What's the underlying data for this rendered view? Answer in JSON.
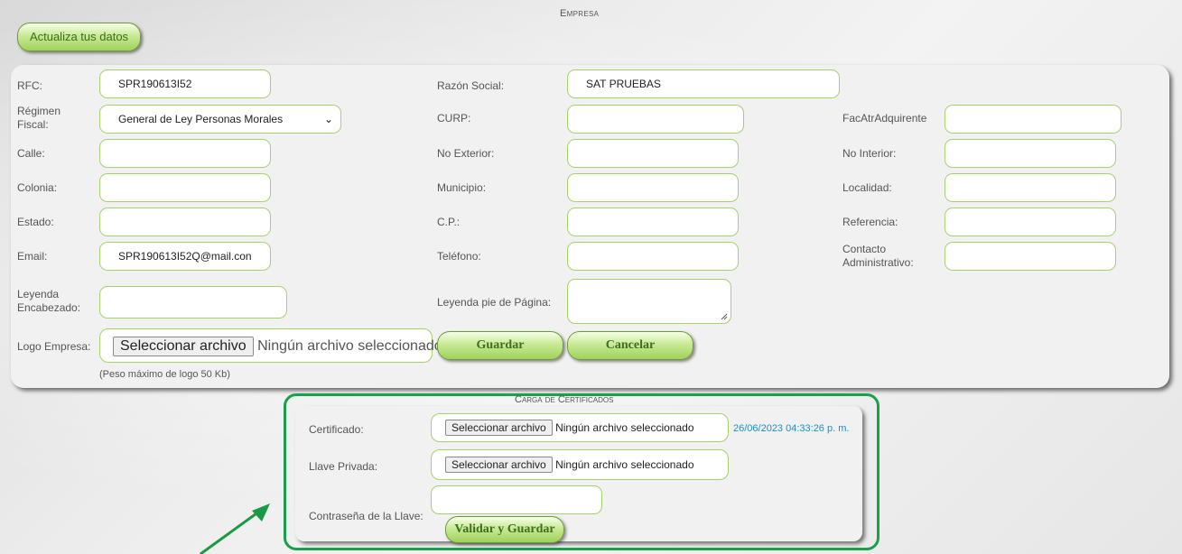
{
  "header": {
    "title": "Empresa",
    "update_button": "Actualiza tus datos"
  },
  "form": {
    "rfc": {
      "label": "RFC:",
      "value": "SPR190613I52"
    },
    "razon_social": {
      "label": "Razón Social:",
      "value": "SAT PRUEBAS"
    },
    "regimen_fiscal": {
      "label_line1": "Régimen",
      "label_line2": "Fiscal:",
      "value": "General de Ley Personas Morales"
    },
    "curp": {
      "label": "CURP:",
      "value": ""
    },
    "fac_atr": {
      "label": "FacAtrAdquirente",
      "value": ""
    },
    "calle": {
      "label": "Calle:",
      "value": ""
    },
    "no_exterior": {
      "label": "No Exterior:",
      "value": ""
    },
    "no_interior": {
      "label": "No Interior:",
      "value": ""
    },
    "colonia": {
      "label": "Colonia:",
      "value": ""
    },
    "municipio": {
      "label": "Municipio:",
      "value": ""
    },
    "localidad": {
      "label": "Localidad:",
      "value": ""
    },
    "estado": {
      "label": "Estado:",
      "value": ""
    },
    "cp": {
      "label": "C.P.:",
      "value": ""
    },
    "referencia": {
      "label": "Referencia:",
      "value": ""
    },
    "email": {
      "label": "Email:",
      "value": "SPR190613I52Q@mail.con"
    },
    "telefono": {
      "label": "Teléfono:",
      "value": ""
    },
    "contacto": {
      "label_line1": "Contacto",
      "label_line2": "Administrativo:",
      "value": ""
    },
    "leyenda_encabezado": {
      "label_line1": "Leyenda",
      "label_line2": "Encabezado:",
      "value": ""
    },
    "leyenda_pie": {
      "label": "Leyenda pie de Página:",
      "value": ""
    },
    "logo": {
      "label": "Logo Empresa:",
      "button": "Seleccionar archivo",
      "status": "Ningún archivo seleccionado"
    },
    "logo_note": "(Peso máximo de logo 50 Kb)",
    "save_button": "Guardar",
    "cancel_button": "Cancelar"
  },
  "certificates": {
    "title": "Carga de Certificados",
    "certificado": {
      "label": "Certificado:",
      "button": "Seleccionar archivo",
      "status": "Ningún archivo seleccionado",
      "date": "26/06/2023 04:33:26 p. m."
    },
    "llave_privada": {
      "label": "Llave Privada:",
      "button": "Seleccionar archivo",
      "status": "Ningún archivo seleccionado"
    },
    "contrasena": {
      "label": "Contraseña de la Llave:",
      "value": ""
    },
    "validate_button": "Validar y Guardar"
  },
  "colors": {
    "accent_green": "#1aa04a",
    "button_green": "#9fd15a",
    "date_blue": "#1b8fc9"
  }
}
